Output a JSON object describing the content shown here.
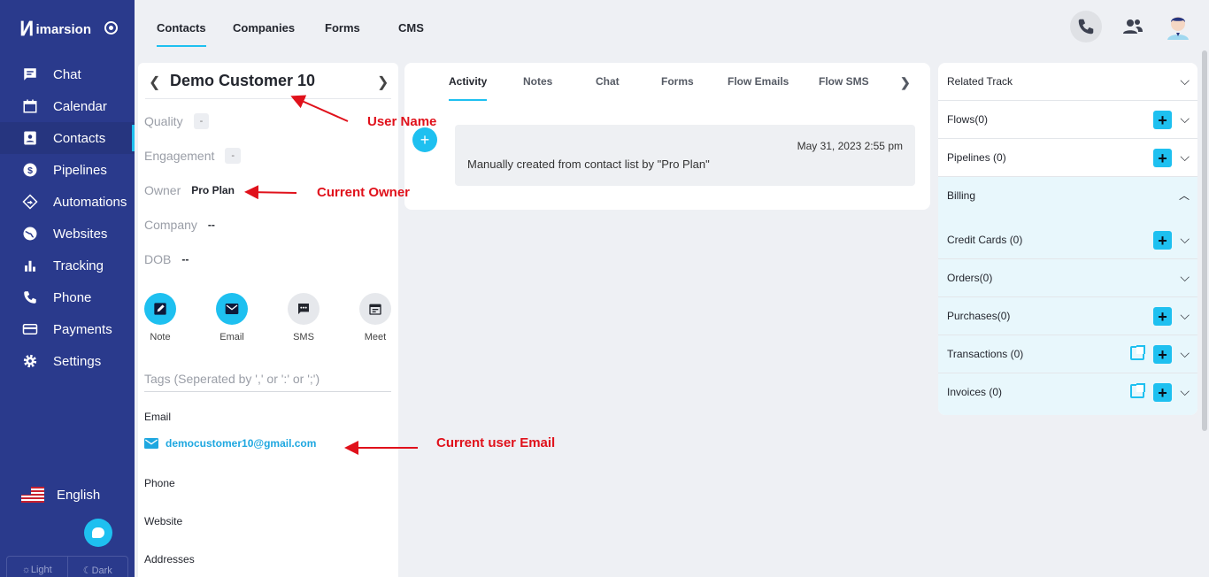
{
  "brand": {
    "mark": "Ͷ",
    "name": "imarsion"
  },
  "sidebar": {
    "items": [
      {
        "label": "Chat",
        "icon": "chat-icon"
      },
      {
        "label": "Calendar",
        "icon": "calendar-icon"
      },
      {
        "label": "Contacts",
        "icon": "contacts-icon",
        "active": true
      },
      {
        "label": "Pipelines",
        "icon": "pipelines-icon"
      },
      {
        "label": "Automations",
        "icon": "automations-icon"
      },
      {
        "label": "Websites",
        "icon": "websites-icon"
      },
      {
        "label": "Tracking",
        "icon": "tracking-icon"
      },
      {
        "label": "Phone",
        "icon": "phone-icon"
      },
      {
        "label": "Payments",
        "icon": "payments-icon"
      },
      {
        "label": "Settings",
        "icon": "settings-icon"
      }
    ],
    "language": "English",
    "theme": {
      "light": "☼Light",
      "dark": "☾Dark"
    }
  },
  "topbar": {
    "tabs": [
      "Contacts",
      "Companies",
      "Forms",
      "CMS"
    ]
  },
  "contact": {
    "name": "Demo Customer 10",
    "quality_label": "Quality",
    "quality_value": "-",
    "engagement_label": "Engagement",
    "engagement_value": "-",
    "owner_label": "Owner",
    "owner_value": "Pro Plan",
    "company_label": "Company",
    "company_value": "--",
    "dob_label": "DOB",
    "dob_value": "--",
    "actions": [
      "Note",
      "Email",
      "SMS",
      "Meet"
    ],
    "tags_placeholder": "Tags (Seperated by ',' or ':' or ';')",
    "email_label": "Email",
    "email_value": "democustomer10@gmail.com",
    "phone_label": "Phone",
    "website_label": "Website",
    "addresses_label": "Addresses"
  },
  "activity": {
    "tabs": [
      "Activity",
      "Notes",
      "Chat",
      "Forms",
      "Flow Emails",
      "Flow SMS"
    ],
    "date": "May 31, 2023 2:55 pm",
    "text": "Manually created from contact list by \"Pro Plan\""
  },
  "related": {
    "title": "Related Track",
    "flows": "Flows(0)",
    "pipelines": "Pipelines (0)",
    "billing": "Billing",
    "credit_cards": "Credit Cards (0)",
    "orders": "Orders(0)",
    "purchases": "Purchases(0)",
    "transactions": "Transactions (0)",
    "invoices": "Invoices (0)"
  },
  "annotations": {
    "user_name": "User Name",
    "current_owner": "Current Owner",
    "current_email": "Current user Email"
  },
  "colors": {
    "sidebar": "#2a3a8c",
    "accent": "#1ec0f0",
    "annotation": "#e0111b"
  }
}
